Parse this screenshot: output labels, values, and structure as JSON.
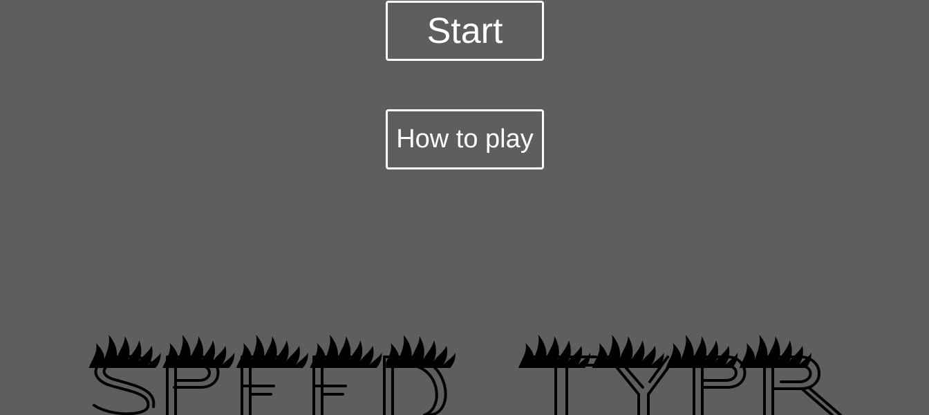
{
  "menu": {
    "start_label": "Start",
    "how_to_play_label": "How to play"
  },
  "logo": {
    "text": "SPEED TYPR"
  },
  "colors": {
    "background": "#5e5e5e",
    "button_border": "#ffffff",
    "button_text": "#ffffff",
    "logo_ink": "#000000"
  }
}
